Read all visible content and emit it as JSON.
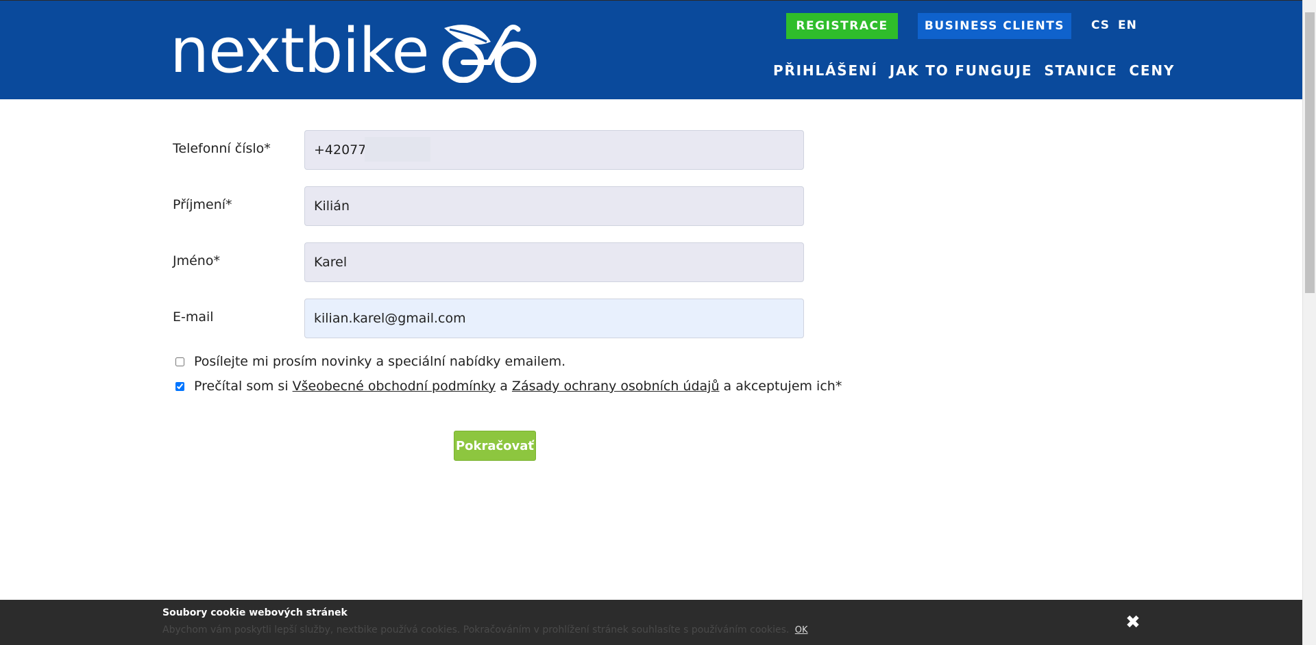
{
  "header": {
    "logo_text": "nextbike",
    "register_label": "REGISTRACE",
    "business_label": "BUSINESS CLIENTS",
    "lang_cs": "CS",
    "lang_en": "EN",
    "nav": [
      "PŘIHLÁŠENÍ",
      "JAK TO FUNGUJE",
      "STANICE",
      "CENY"
    ],
    "colors": {
      "header_bg": "#0a4a9c",
      "register_bg": "#2fbd2b",
      "business_bg": "#0f62cc"
    }
  },
  "form": {
    "phone_label": "Telefonní číslo*",
    "phone_value": "+420777",
    "surname_label": "Příjmení*",
    "surname_value": "Kilián",
    "name_label": "Jméno*",
    "name_value": "Karel",
    "email_label": "E-mail",
    "email_value": "kilian.karel@gmail.com",
    "newsletter_label": "Posílejte mi prosím novinky a speciální nabídky emailem.",
    "newsletter_checked": false,
    "terms_prefix": "Prečítal som si ",
    "terms_link1": "Všeobecné obchodní podmínky",
    "terms_mid": " a ",
    "terms_link2": "Zásady ochrany osobních údajů",
    "terms_suffix": " a akceptujem ich*",
    "terms_checked": true,
    "submit_label": "Pokračovať",
    "submit_color": "#8dc63f"
  },
  "cookie": {
    "title": "Soubory cookie webových stránek",
    "text": "Abychom vám poskytli lepší služby, nextbike používá cookies. Pokračováním v prohlížení stránek souhlasíte s používáním cookies.",
    "ok_label": "OK",
    "close_icon": "✖"
  }
}
